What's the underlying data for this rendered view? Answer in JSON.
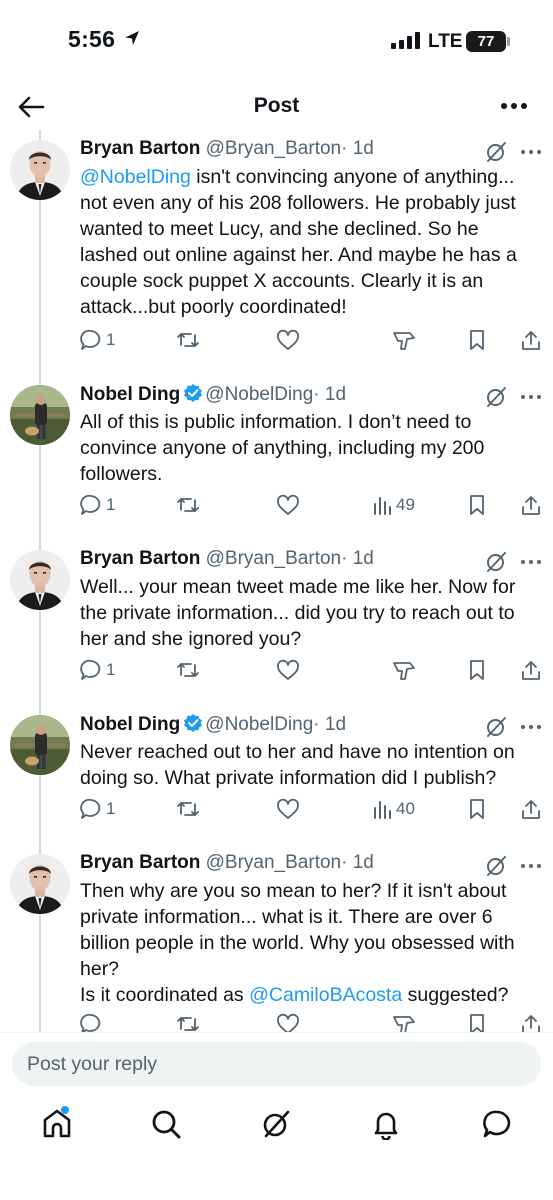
{
  "status_bar": {
    "time": "5:56",
    "network": "LTE",
    "battery": "77"
  },
  "header": {
    "title": "Post"
  },
  "replies": [
    {
      "name": "Bryan Barton",
      "handle": "@Bryan_Barton",
      "time": "· 1d",
      "verified": false,
      "text_parts": [
        {
          "text": "@NobelDing",
          "mention": true
        },
        {
          "text": " isn't convincing anyone of anything... not even any of his 208 followers.  He probably just wanted to meet Lucy, and she declined.  So he lashed out online against her.  And maybe he has a couple sock puppet X accounts. Clearly it is an attack...but poorly coordinated!",
          "mention": false
        }
      ],
      "reply_count": "1",
      "views": ""
    },
    {
      "name": "Nobel Ding",
      "handle": "@NobelDing",
      "time": "· 1d",
      "verified": true,
      "text_parts": [
        {
          "text": "All of this is public information. I don’t need to convince anyone of anything, including my 200 followers.",
          "mention": false
        }
      ],
      "reply_count": "1",
      "views": "49"
    },
    {
      "name": "Bryan Barton",
      "handle": "@Bryan_Barton",
      "time": "· 1d",
      "verified": false,
      "text_parts": [
        {
          "text": "Well... your mean tweet made me like her.  Now for the private information... did you try to reach out to her and she ignored you?",
          "mention": false
        }
      ],
      "reply_count": "1",
      "views": ""
    },
    {
      "name": "Nobel Ding",
      "handle": "@NobelDing",
      "time": "· 1d",
      "verified": true,
      "text_parts": [
        {
          "text": "Never reached out to her and have no intention on doing so. What private information did I publish?",
          "mention": false
        }
      ],
      "reply_count": "1",
      "views": "40"
    },
    {
      "name": "Bryan Barton",
      "handle": "@Bryan_Barton",
      "time": "· 1d",
      "verified": false,
      "text_parts": [
        {
          "text": "Then why are you so mean to her?  If it isn't  about private information... what is it.  There are over 6 billion people in the world. Why you obsessed with her?\nIs it coordinated as ",
          "mention": false
        },
        {
          "text": "@CamiloBAcosta",
          "mention": true
        },
        {
          "text": " suggested?",
          "mention": false
        }
      ],
      "reply_count": "",
      "views": ""
    }
  ],
  "composer": {
    "placeholder": "Post your reply"
  },
  "icons": {
    "back": "arrow-left-icon",
    "more": "more-horizontal-icon",
    "grok": "grok-icon",
    "reply": "reply-bubble-icon",
    "repost": "repost-icon",
    "like": "heart-icon",
    "analytics": "analytics-icon",
    "dislike": "downvote-icon",
    "bookmark": "bookmark-icon",
    "share": "share-icon",
    "home": "home-icon",
    "search": "search-icon",
    "notifications": "bell-icon",
    "messages": "message-icon"
  },
  "colors": {
    "accent": "#1d9bf0",
    "secondary_text": "#536471",
    "thread_line": "#cfd9de"
  }
}
